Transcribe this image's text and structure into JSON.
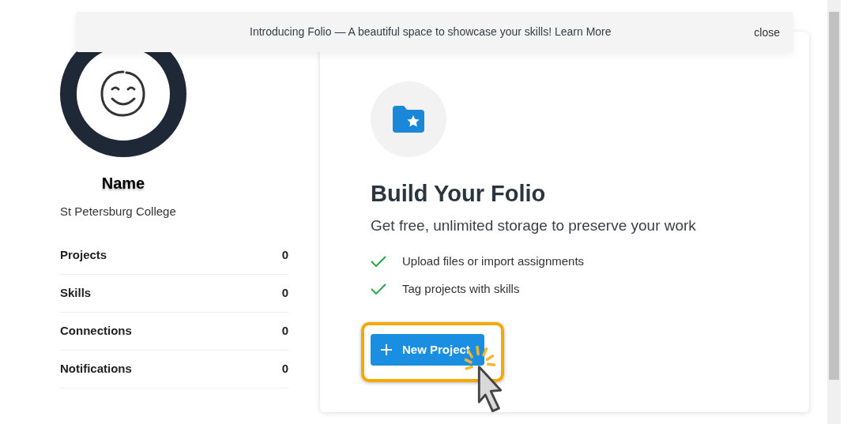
{
  "banner": {
    "message": "Introducing Folio — A beautiful space to showcase your skills! Learn More",
    "close": "close"
  },
  "profile": {
    "name": "Name",
    "school": "St Petersburg College"
  },
  "stats": [
    {
      "label": "Projects",
      "count": "0"
    },
    {
      "label": "Skills",
      "count": "0"
    },
    {
      "label": "Connections",
      "count": "0"
    },
    {
      "label": "Notifications",
      "count": "0"
    }
  ],
  "card": {
    "title": "Build Your Folio",
    "subtitle": "Get free, unlimited storage to preserve your work",
    "features": [
      "Upload files or import assignments",
      "Tag projects with skills"
    ],
    "button": "New Project"
  }
}
